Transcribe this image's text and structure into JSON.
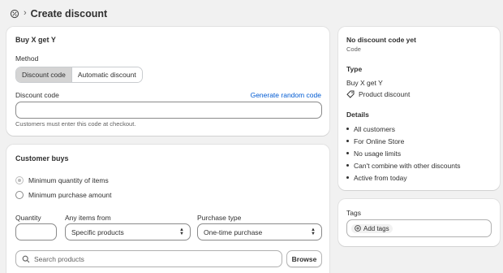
{
  "header": {
    "title": "Create discount"
  },
  "main": {
    "section_title": "Buy X get Y",
    "method": {
      "label": "Method",
      "options": [
        "Discount code",
        "Automatic discount"
      ],
      "selected": "Discount code"
    },
    "discount_code": {
      "label": "Discount code",
      "generate_link": "Generate random code",
      "value": "",
      "help": "Customers must enter this code at checkout."
    },
    "customer_buys": {
      "title": "Customer buys",
      "options": [
        "Minimum quantity of items",
        "Minimum purchase amount"
      ],
      "selected": "Minimum quantity of items",
      "quantity_label": "Quantity",
      "quantity_value": "",
      "any_items_label": "Any items from",
      "any_items_value": "Specific products",
      "purchase_type_label": "Purchase type",
      "purchase_type_value": "One-time purchase",
      "search_placeholder": "Search products",
      "browse_label": "Browse"
    }
  },
  "summary": {
    "code_title": "No discount code yet",
    "code_subtitle": "Code",
    "type_heading": "Type",
    "type_value": "Buy X get Y",
    "type_item": "Product discount",
    "details_heading": "Details",
    "details": [
      "All customers",
      "For Online Store",
      "No usage limits",
      "Can't combine with other discounts",
      "Active from today"
    ]
  },
  "tags": {
    "heading": "Tags",
    "add_label": "Add tags"
  },
  "colors": {
    "background": "#f1f1f1",
    "card": "#ffffff",
    "link": "#005bd3",
    "segment_selected": "#d4d4d4"
  },
  "icons": [
    "discount-icon",
    "chevron-right-icon",
    "price-tag-icon",
    "select-arrows-icon",
    "search-icon",
    "plus-circle-icon"
  ]
}
